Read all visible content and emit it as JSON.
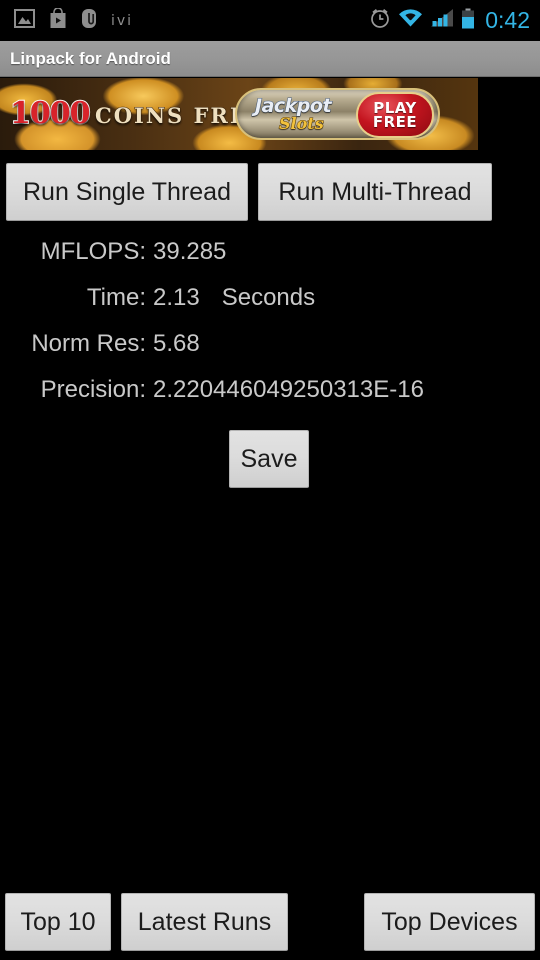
{
  "status_bar": {
    "left_icons": [
      {
        "name": "photo-icon",
        "label": "photo"
      },
      {
        "name": "play-store-icon",
        "label": "play-store"
      },
      {
        "name": "paperclip-icon",
        "label": "attachment"
      }
    ],
    "brand_label": "ivi",
    "right_icons": [
      {
        "name": "alarm-clock-icon",
        "label": "alarm"
      },
      {
        "name": "wifi-icon",
        "label": "wifi"
      },
      {
        "name": "signal-bars-icon",
        "label": "signal"
      },
      {
        "name": "battery-icon",
        "label": "battery"
      }
    ],
    "clock": "0:42",
    "accent_color": "#33b5e5",
    "icon_gray": "#8e8e8e"
  },
  "title_bar": {
    "title": "Linpack for Android",
    "background_color": "#969696",
    "text_color": "#ffffff"
  },
  "ad_banner": {
    "headline_number": "1000",
    "headline_text": "COINS FREE",
    "brand_top": "Jackpot",
    "brand_bottom": "Slots",
    "cta_line1": "PLAY",
    "cta_line2": "FREE",
    "cta_color": "#c4151f",
    "number_color": "#d8232a"
  },
  "actions": {
    "run_single_label": "Run Single Thread",
    "run_multi_label": "Run Multi-Thread",
    "save_label": "Save"
  },
  "results": [
    {
      "label": "MFLOPS:",
      "value": "39.285",
      "unit": ""
    },
    {
      "label": "Time:",
      "value": "2.13",
      "unit": "Seconds"
    },
    {
      "label": "Norm Res:",
      "value": "5.68",
      "unit": ""
    },
    {
      "label": "Precision:",
      "value": "2.220446049250313E-16",
      "unit": ""
    }
  ],
  "bottom_bar": {
    "top10_label": "Top 10",
    "latest_runs_label": "Latest Runs",
    "top_devices_label": "Top Devices"
  },
  "theme": {
    "background": "#000000",
    "text_color": "#c9c9c9",
    "button_face": "#dcdcdc",
    "button_text": "#1c1c1c"
  }
}
